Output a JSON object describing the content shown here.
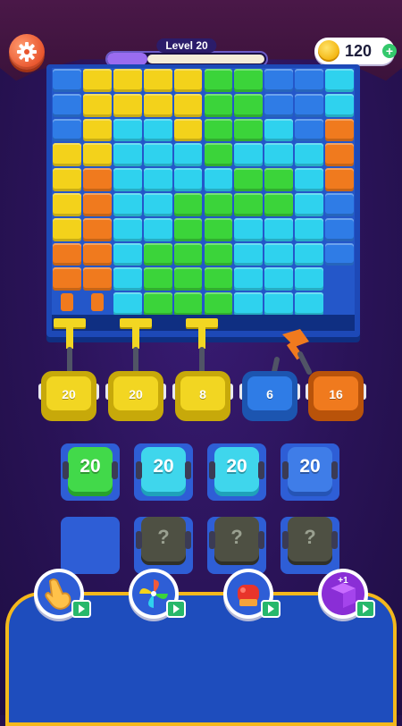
{
  "header": {
    "level_label": "Level 20",
    "progress_fraction": 0.25,
    "coins": "120",
    "settings_icon": "gear-icon",
    "coin_icon": "coin-icon",
    "add_coins_icon": "plus-icon"
  },
  "colors": {
    "blue": "#2f7ce6",
    "yellow": "#f3d21b",
    "cyan": "#2fd2ee",
    "green": "#3bd43a",
    "orange": "#f07a1e",
    "board": "#1d49b7"
  },
  "board": {
    "grid": [
      [
        "B",
        "Y",
        "Y",
        "Y",
        "Y",
        "G",
        "G",
        "B",
        "B",
        "C"
      ],
      [
        "B",
        "Y",
        "Y",
        "Y",
        "Y",
        "G",
        "G",
        "B",
        "B",
        "C"
      ],
      [
        "B",
        "Y",
        "C",
        "C",
        "Y",
        "G",
        "G",
        "C",
        "B",
        "O"
      ],
      [
        "Y",
        "Y",
        "C",
        "C",
        "C",
        "G",
        "C",
        "C",
        "C",
        "O"
      ],
      [
        "Y",
        "O",
        "C",
        "C",
        "C",
        "C",
        "G",
        "G",
        "C",
        "O"
      ],
      [
        "Y",
        "O",
        "C",
        "C",
        "G",
        "G",
        "G",
        "G",
        "C",
        "B"
      ],
      [
        "Y",
        "O",
        "C",
        "C",
        "G",
        "G",
        "C",
        "C",
        "C",
        "B"
      ],
      [
        "O",
        "O",
        "C",
        "G",
        "G",
        "G",
        "C",
        "C",
        "C",
        "B"
      ],
      [
        "O",
        "O",
        "C",
        "G",
        "G",
        "G",
        "C",
        "C",
        "C",
        "."
      ],
      [
        ".",
        ".",
        "C",
        "G",
        "G",
        "G",
        "C",
        "C",
        "C",
        "."
      ]
    ]
  },
  "trucks": [
    {
      "label": "20",
      "color": "#f2d622",
      "dark": "#c7a90a"
    },
    {
      "label": "20",
      "color": "#f2d622",
      "dark": "#c7a90a"
    },
    {
      "label": "8",
      "color": "#f2d622",
      "dark": "#c7a90a"
    },
    {
      "label": "6",
      "color": "#2f7ce6",
      "dark": "#1c55b0"
    },
    {
      "label": "16",
      "color": "#f07a1e",
      "dark": "#b9530a"
    }
  ],
  "queue": {
    "row1": [
      {
        "label": "20",
        "color": "#42d94a",
        "dark": "#27a22d"
      },
      {
        "label": "20",
        "color": "#3fd6ec",
        "dark": "#1fa2ba"
      },
      {
        "label": "20",
        "color": "#3fd6ec",
        "dark": "#1fa2ba"
      },
      {
        "label": "20",
        "color": "#3f7de8",
        "dark": "#2554b5"
      }
    ],
    "row2": [
      {
        "label": ""
      },
      {
        "label": "?"
      },
      {
        "label": "?"
      },
      {
        "label": "?"
      }
    ]
  },
  "boosters": [
    {
      "icon": "pointing-hand-icon",
      "ad_icon": "video-ad-icon"
    },
    {
      "icon": "pinwheel-icon",
      "ad_icon": "video-ad-icon"
    },
    {
      "icon": "boxing-glove-icon",
      "ad_icon": "video-ad-icon"
    },
    {
      "icon": "cube-plus-icon",
      "label": "+1",
      "ad_icon": "video-ad-icon"
    }
  ]
}
